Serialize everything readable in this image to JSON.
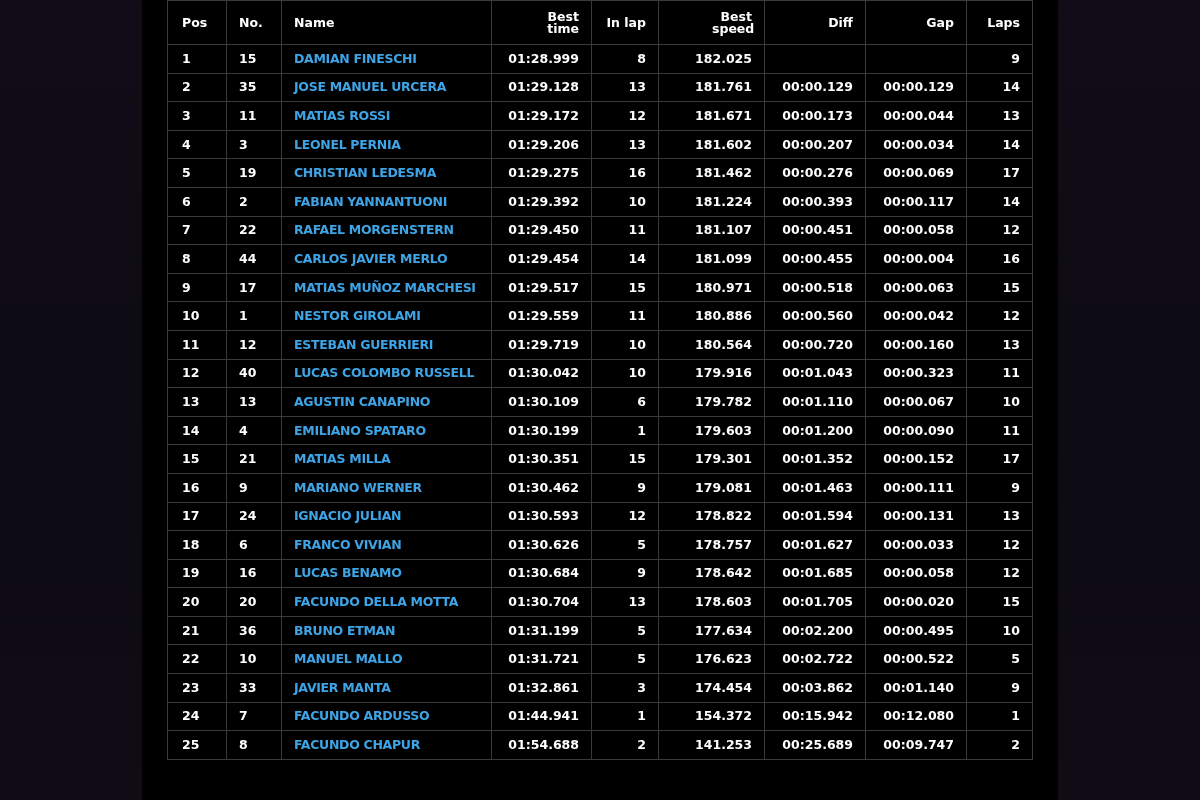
{
  "table": {
    "columns": [
      "Pos",
      "No.",
      "Name",
      "Best time",
      "In lap",
      "Best speed",
      "Diff",
      "Gap",
      "Laps"
    ],
    "rows": [
      [
        "1",
        "15",
        "DAMIAN FINESCHI",
        "01:28.999",
        "8",
        "182.025",
        "",
        "",
        "9"
      ],
      [
        "2",
        "35",
        "JOSE MANUEL URCERA",
        "01:29.128",
        "13",
        "181.761",
        "00:00.129",
        "00:00.129",
        "14"
      ],
      [
        "3",
        "11",
        "MATIAS ROSSI",
        "01:29.172",
        "12",
        "181.671",
        "00:00.173",
        "00:00.044",
        "13"
      ],
      [
        "4",
        "3",
        "LEONEL PERNIA",
        "01:29.206",
        "13",
        "181.602",
        "00:00.207",
        "00:00.034",
        "14"
      ],
      [
        "5",
        "19",
        "CHRISTIAN LEDESMA",
        "01:29.275",
        "16",
        "181.462",
        "00:00.276",
        "00:00.069",
        "17"
      ],
      [
        "6",
        "2",
        "FABIAN YANNANTUONI",
        "01:29.392",
        "10",
        "181.224",
        "00:00.393",
        "00:00.117",
        "14"
      ],
      [
        "7",
        "22",
        "RAFAEL MORGENSTERN",
        "01:29.450",
        "11",
        "181.107",
        "00:00.451",
        "00:00.058",
        "12"
      ],
      [
        "8",
        "44",
        "CARLOS JAVIER MERLO",
        "01:29.454",
        "14",
        "181.099",
        "00:00.455",
        "00:00.004",
        "16"
      ],
      [
        "9",
        "17",
        "MATIAS MUÑOZ MARCHESI",
        "01:29.517",
        "15",
        "180.971",
        "00:00.518",
        "00:00.063",
        "15"
      ],
      [
        "10",
        "1",
        "NESTOR GIROLAMI",
        "01:29.559",
        "11",
        "180.886",
        "00:00.560",
        "00:00.042",
        "12"
      ],
      [
        "11",
        "12",
        "ESTEBAN GUERRIERI",
        "01:29.719",
        "10",
        "180.564",
        "00:00.720",
        "00:00.160",
        "13"
      ],
      [
        "12",
        "40",
        "LUCAS COLOMBO RUSSELL",
        "01:30.042",
        "10",
        "179.916",
        "00:01.043",
        "00:00.323",
        "11"
      ],
      [
        "13",
        "13",
        "AGUSTIN CANAPINO",
        "01:30.109",
        "6",
        "179.782",
        "00:01.110",
        "00:00.067",
        "10"
      ],
      [
        "14",
        "4",
        "EMILIANO SPATARO",
        "01:30.199",
        "1",
        "179.603",
        "00:01.200",
        "00:00.090",
        "11"
      ],
      [
        "15",
        "21",
        "MATIAS MILLA",
        "01:30.351",
        "15",
        "179.301",
        "00:01.352",
        "00:00.152",
        "17"
      ],
      [
        "16",
        "9",
        "MARIANO WERNER",
        "01:30.462",
        "9",
        "179.081",
        "00:01.463",
        "00:00.111",
        "9"
      ],
      [
        "17",
        "24",
        "IGNACIO JULIAN",
        "01:30.593",
        "12",
        "178.822",
        "00:01.594",
        "00:00.131",
        "13"
      ],
      [
        "18",
        "6",
        "FRANCO VIVIAN",
        "01:30.626",
        "5",
        "178.757",
        "00:01.627",
        "00:00.033",
        "12"
      ],
      [
        "19",
        "16",
        "LUCAS BENAMO",
        "01:30.684",
        "9",
        "178.642",
        "00:01.685",
        "00:00.058",
        "12"
      ],
      [
        "20",
        "20",
        "FACUNDO DELLA MOTTA",
        "01:30.704",
        "13",
        "178.603",
        "00:01.705",
        "00:00.020",
        "15"
      ],
      [
        "21",
        "36",
        "BRUNO ETMAN",
        "01:31.199",
        "5",
        "177.634",
        "00:02.200",
        "00:00.495",
        "10"
      ],
      [
        "22",
        "10",
        "MANUEL MALLO",
        "01:31.721",
        "5",
        "176.623",
        "00:02.722",
        "00:00.522",
        "5"
      ],
      [
        "23",
        "33",
        "JAVIER MANTA",
        "01:32.861",
        "3",
        "174.454",
        "00:03.862",
        "00:01.140",
        "9"
      ],
      [
        "24",
        "7",
        "FACUNDO ARDUSSO",
        "01:44.941",
        "1",
        "154.372",
        "00:15.942",
        "00:12.080",
        "1"
      ],
      [
        "25",
        "8",
        "FACUNDO CHAPUR",
        "01:54.688",
        "2",
        "141.253",
        "00:25.689",
        "00:09.747",
        "2"
      ]
    ]
  }
}
